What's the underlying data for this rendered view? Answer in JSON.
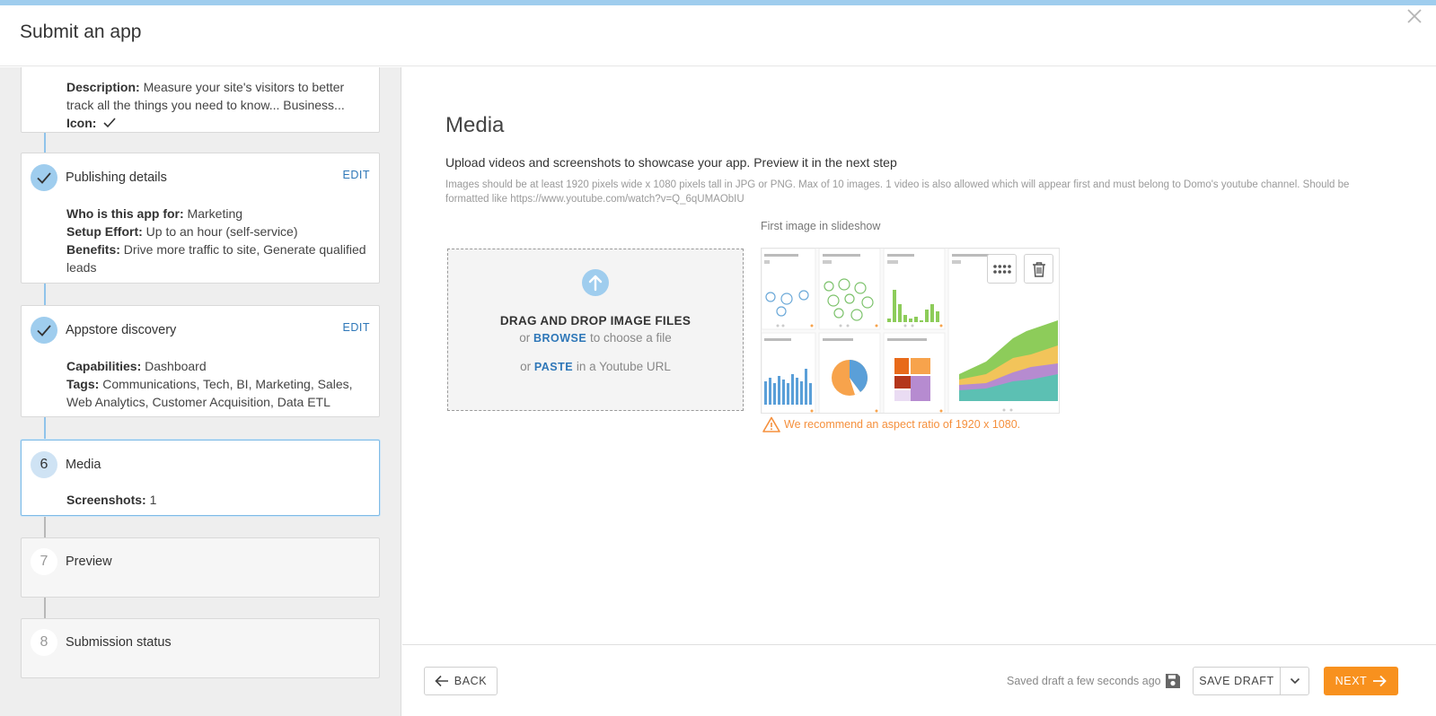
{
  "header": {
    "title": "Submit an app"
  },
  "steps": [
    {
      "name": "",
      "fields": [
        {
          "label": "Description:",
          "value": " Measure your site's visitors to better track all the things you need to know... Business..."
        },
        {
          "label": "Icon:",
          "value": ""
        }
      ]
    },
    {
      "name": "Publishing details",
      "edit_label": "EDIT",
      "fields": [
        {
          "label": "Who is this app for:",
          "value": " Marketing"
        },
        {
          "label": "Setup Effort:",
          "value": " Up to an hour (self-service)"
        },
        {
          "label": "Benefits:",
          "value": " Drive more traffic to site, Generate qualified leads"
        }
      ]
    },
    {
      "name": "Appstore discovery",
      "edit_label": "EDIT",
      "fields": [
        {
          "label": "Capabilities:",
          "value": " Dashboard"
        },
        {
          "label": "Tags:",
          "value": " Communications, Tech, BI, Marketing, Sales, Web Analytics, Customer Acquisition, Data ETL"
        }
      ]
    },
    {
      "number": "6",
      "name": "Media",
      "fields": [
        {
          "label": "Screenshots:",
          "value": " 1"
        }
      ]
    },
    {
      "number": "7",
      "name": "Preview"
    },
    {
      "number": "8",
      "name": "Submission status"
    }
  ],
  "media": {
    "title": "Media",
    "description": "Upload videos and screenshots to showcase your app. Preview it in the next step",
    "note": "Images should be at least 1920 pixels wide x 1080 pixels tall in JPG or PNG. Max of 10 images. 1 video is also allowed which will appear first and must belong to Domo's youtube channel. Should be formatted like https://www.youtube.com/watch?v=Q_6qUMAObIU",
    "slideshow_label": "First image in slideshow",
    "dropzone": {
      "title": "DRAG AND DROP IMAGE FILES",
      "or1": "or ",
      "browse": "BROWSE",
      "browse_suffix": " to choose a file",
      "or2": "or ",
      "paste": "PASTE",
      "paste_suffix": " in a Youtube URL"
    },
    "warning": "We recommend an aspect ratio of 1920 x 1080."
  },
  "footer": {
    "back_label": "BACK",
    "saved_text": "Saved draft a few seconds ago",
    "save_draft_label": "SAVE DRAFT",
    "next_label": "NEXT"
  },
  "colors": {
    "accent_blue": "#2e77b8",
    "step_done": "#9fcdee",
    "next_orange": "#f8911e",
    "warning_orange": "#f5903d"
  }
}
